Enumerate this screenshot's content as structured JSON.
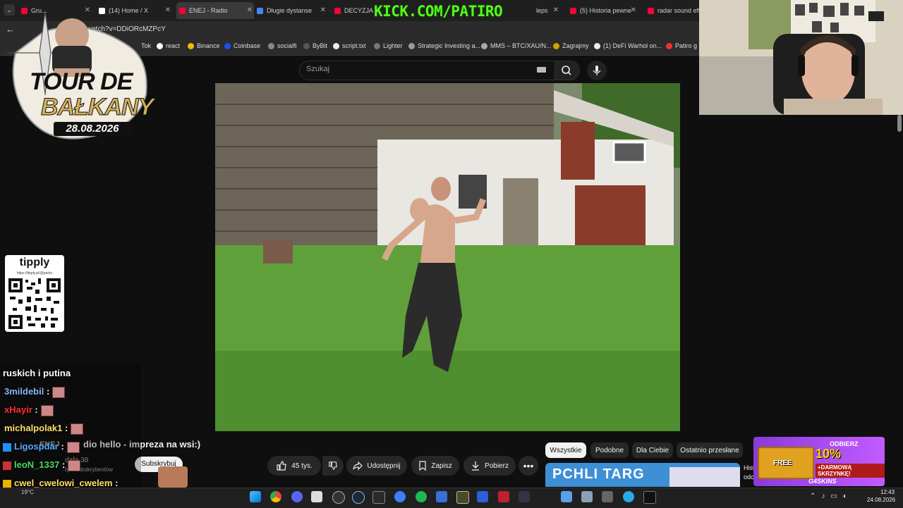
{
  "browser": {
    "tabs": [
      {
        "label": "Gru...",
        "color": "#ff0033"
      },
      {
        "label": "(14) Home / X",
        "color": "#ffffff"
      },
      {
        "label": "ENEJ - Radio",
        "color": "#ff0033"
      },
      {
        "label": "Długie dystanse",
        "color": "#4285f4"
      },
      {
        "label": "DECYZJA S",
        "color": "#ff0033"
      },
      {
        "label": "leps",
        "color": "#ff0033"
      },
      {
        "label": "(5) Historia pewne",
        "color": "#ff0033"
      },
      {
        "label": "radar sound effe",
        "color": "#ff0033"
      }
    ],
    "url": "/watch?v=DDiORcMZPcY",
    "bookmarks": [
      {
        "label": "Tok",
        "color": "#222"
      },
      {
        "label": "react",
        "color": "#222"
      },
      {
        "label": "Binance",
        "color": "#f0b90b"
      },
      {
        "label": "Coinbase",
        "color": "#1652f0"
      },
      {
        "label": "socialfi",
        "color": "#666"
      },
      {
        "label": "ByBit",
        "color": "#222"
      },
      {
        "label": "script.txt",
        "color": "#666"
      },
      {
        "label": "Lighter",
        "color": "#444"
      },
      {
        "label": "Strategic Investing a...",
        "color": "#888"
      },
      {
        "label": "MMS – BTC/XAU/N...",
        "color": "#888"
      },
      {
        "label": "Zagrajmy",
        "color": "#d4a000"
      },
      {
        "label": "(1) DeFi Warhol on...",
        "color": "#222"
      },
      {
        "label": "Patiro g",
        "color": "#e33"
      }
    ]
  },
  "overlay": {
    "kick_banner": "KICK.COM/PATIRO",
    "logo_line1": "TOUR DE",
    "logo_line2": "BAŁKANY",
    "logo_date": "28.08.2026",
    "tipply_title": "tipply",
    "tipply_url": "https://tipply.pl/@patiro"
  },
  "youtube": {
    "search_placeholder": "Szukaj",
    "channel_name": "ENEJ",
    "video_title_fragment": "dio hello - impreza na wsi:)",
    "subscribers": "dafa 38",
    "subscribers_label": "tys. subskrybentów",
    "subscribe_label": "Subskrybuj",
    "likes": "45 tys.",
    "share_label": "Udostępnij",
    "save_label": "Zapisz",
    "download_label": "Pobierz",
    "filter_chips": [
      "Wszystkie",
      "Podobne",
      "Dla Ciebie",
      "Ostatnio przesłane"
    ],
    "rec_title": "PCHLI TARG",
    "rec_side_text1": "Hist",
    "rec_side_text2": "odc."
  },
  "chat": [
    {
      "user": "ruskich i putina",
      "color": "#ffffff",
      "msg": ""
    },
    {
      "user": "3mildebil",
      "color": "#8ab4ff",
      "msg": ":"
    },
    {
      "user": "xHayir",
      "color": "#ff3030",
      "msg": ":"
    },
    {
      "user": "michalpolak1",
      "color": "#ffe066",
      "msg": ":"
    },
    {
      "user": "Ligospdar",
      "color": "#59a8ff",
      "msg": ":"
    },
    {
      "user": "leoN_1337",
      "color": "#4cd964",
      "msg": ":"
    },
    {
      "user": "cwel_cwelowi_cwelem",
      "color": "#ffe066",
      "msg": ":"
    },
    {
      "user": "majslaburz",
      "color": "#ffffff",
      "msg": ""
    }
  ],
  "emote_badge": "x5",
  "promo": {
    "line1": "ODBIERZ",
    "line2": "10% BONUSU",
    "line3": "+DARMOWĄ SKRZYNKĘ!",
    "free": "FREE",
    "brand": "G4SKINS"
  },
  "taskbar": {
    "time": "12:43",
    "date": "24.08.2026",
    "weather": "19°C"
  }
}
